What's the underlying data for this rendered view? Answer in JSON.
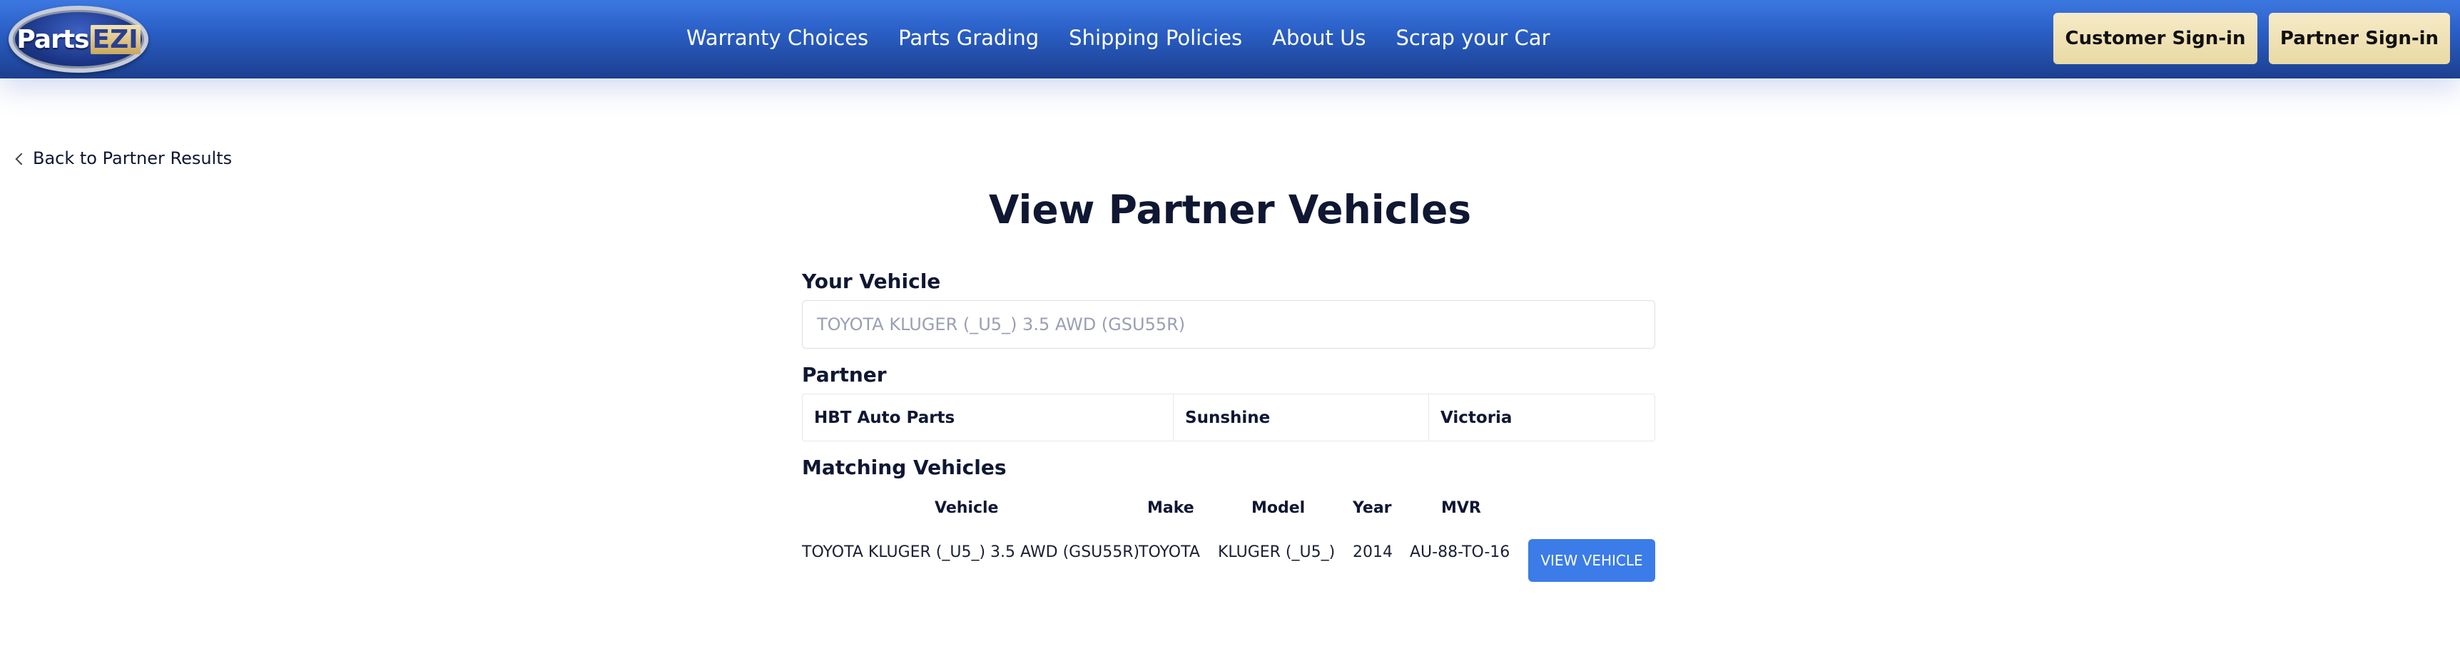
{
  "header": {
    "logo": {
      "main": "Parts",
      "accent": "EZI"
    },
    "nav": [
      "Warranty Choices",
      "Parts Grading",
      "Shipping Policies",
      "About Us",
      "Scrap your Car"
    ],
    "customer_signin": "Customer Sign-in",
    "partner_signin": "Partner Sign-in"
  },
  "back_link": "Back to Partner Results",
  "page_title": "View Partner Vehicles",
  "your_vehicle": {
    "label": "Your Vehicle",
    "placeholder": "TOYOTA KLUGER (_U5_) 3.5 AWD (GSU55R)"
  },
  "partner": {
    "label": "Partner",
    "name": "HBT Auto Parts",
    "suburb": "Sunshine",
    "state": "Victoria"
  },
  "matching": {
    "label": "Matching Vehicles",
    "columns": [
      "Vehicle",
      "Make",
      "Model",
      "Year",
      "MVR"
    ],
    "rows": [
      {
        "vehicle": "TOYOTA KLUGER (_U5_) 3.5 AWD (GSU55R)",
        "make": "TOYOTA",
        "model": "KLUGER (_U5_)",
        "year": "2014",
        "mvr": "AU-88-TO-16",
        "action": "VIEW VEHICLE"
      }
    ]
  },
  "colors": {
    "header_top": "#3c78e0",
    "header_bottom": "#1c3f8f",
    "signin_bg": "#f1e4b8",
    "primary_button": "#3b7ce8",
    "text_dark": "#0f1733"
  }
}
